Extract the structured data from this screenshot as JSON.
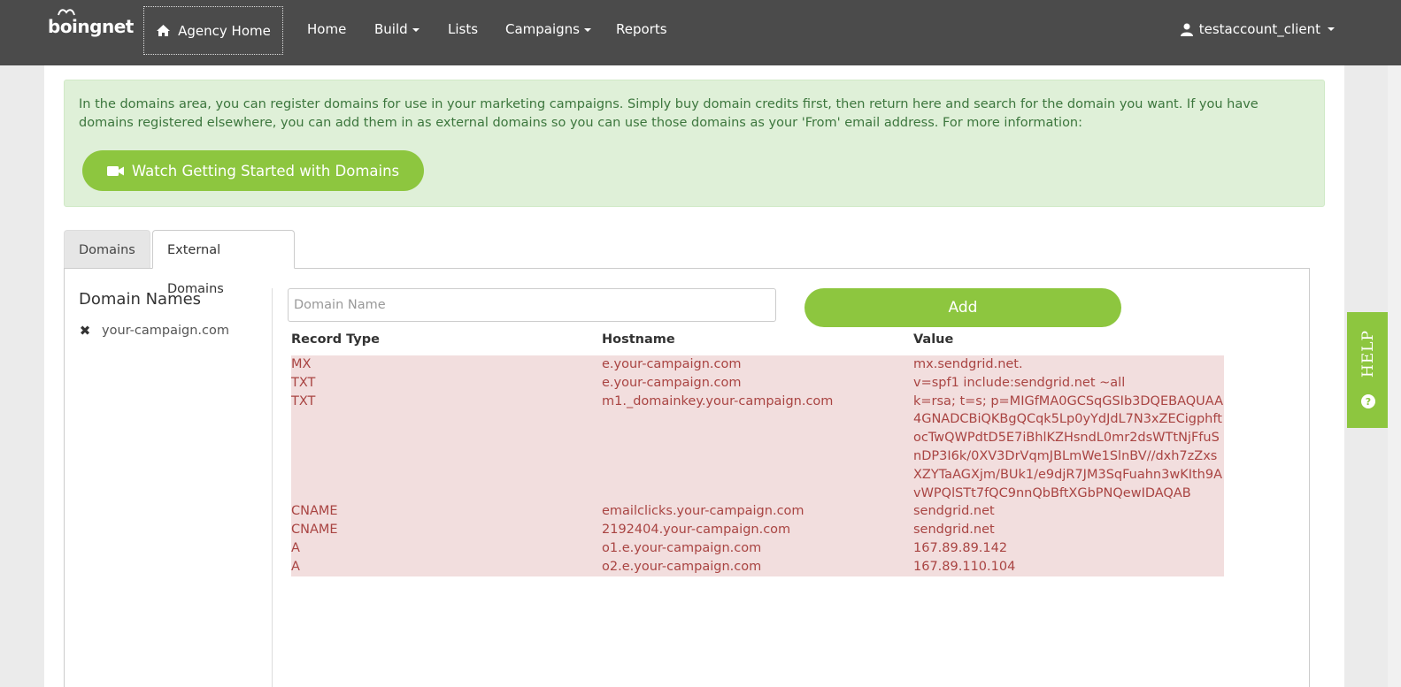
{
  "navbar": {
    "logo_text": "boingnet",
    "agency_home": "Agency Home",
    "links": [
      "Home",
      "Build",
      "Lists",
      "Campaigns",
      "Reports"
    ],
    "user": "testaccount_client"
  },
  "alert": {
    "text": "In the domains area, you can register domains for use in your marketing campaigns. Simply buy domain credits first, then return here and search for the domain you want. If you have domains registered elsewhere, you can add them in as external domains so you can use those domains as your 'From' email address. For more information:",
    "button_label": "Watch Getting Started with Domains"
  },
  "tabs": [
    {
      "label": "Domains"
    },
    {
      "label": "External Domains"
    }
  ],
  "sidebar": {
    "title": "Domain Names",
    "items": [
      {
        "label": "your-campaign.com"
      }
    ]
  },
  "form": {
    "placeholder": "Domain Name",
    "add_label": "Add"
  },
  "records": {
    "headers": [
      "Record Type",
      "Hostname",
      "Value"
    ],
    "rows": [
      {
        "type": "MX",
        "host": "e.your-campaign.com",
        "value": "mx.sendgrid.net."
      },
      {
        "type": "TXT",
        "host": "e.your-campaign.com",
        "value": "v=spf1 include:sendgrid.net ~all"
      },
      {
        "type": "TXT",
        "host": "m1._domainkey.your-campaign.com",
        "value": "k=rsa; t=s; p=MIGfMA0GCSqGSIb3DQEBAQUAA4GNADCBiQKBgQCqk5Lp0yYdJdL7N3xZECigphftocTwQWPdtD5E7iBhlKZHsndL0mr2dsWTtNjFfuSnDP3I6k/0XV3DrVqmJBLmWe1SlnBV//dxh7zZxsXZYTaAGXjm/BUk1/e9djR7JM3SqFuahn3wKIth9AvWPQlSTt7fQC9nnQbBftXGbPNQewIDAQAB"
      },
      {
        "type": "CNAME",
        "host": "emailclicks.your-campaign.com",
        "value": "sendgrid.net"
      },
      {
        "type": "CNAME",
        "host": "2192404.your-campaign.com",
        "value": "sendgrid.net"
      },
      {
        "type": "A",
        "host": "o1.e.your-campaign.com",
        "value": "167.89.89.142"
      },
      {
        "type": "A",
        "host": "o2.e.your-campaign.com",
        "value": "167.89.110.104"
      }
    ]
  },
  "help": {
    "label": "HELP",
    "icon_glyph": "?"
  },
  "colors": {
    "accent": "#8dc63f",
    "navbar": "#4b4b4b",
    "alert_bg": "#dff0d8",
    "error_bg": "#f2dede",
    "error_text": "#a94442"
  }
}
